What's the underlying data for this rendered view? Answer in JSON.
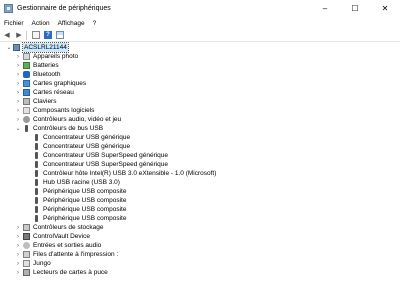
{
  "window": {
    "title": "Gestionnaire de périphériques",
    "minimize": "–",
    "maximize": "☐",
    "close": "✕"
  },
  "menu": [
    "Fichier",
    "Action",
    "Affichage",
    "?"
  ],
  "toolbar": {
    "back": "◀",
    "forward": "▶",
    "help": "?"
  },
  "tree": {
    "root": "ACSLRL21144",
    "categories": [
      "Appareils photo",
      "Batteries",
      "Bluetooth",
      "Cartes graphiques",
      "Cartes réseau",
      "Claviers",
      "Composants logiciels",
      "Contrôleurs audio, vidéo et jeu",
      "Contrôleurs de bus USB"
    ],
    "usb_children": [
      "Concentrateur USB générique",
      "Concentrateur USB générique",
      "Concentrateur USB SuperSpeed générique",
      "Concentrateur USB SuperSpeed générique",
      "Contrôleur hôte Intel(R) USB 3.0 eXtensible - 1.0 (Microsoft)",
      "Hub USB racine (USB 3.0)",
      "Périphérique USB composite",
      "Périphérique USB composite",
      "Périphérique USB composite",
      "Périphérique USB composite"
    ],
    "categories_after": [
      "Contrôleurs de stockage",
      "ControlVault Device",
      "Entrées et sorties audio",
      "Files d'attente à l'impression :",
      "Jungo",
      "Lecteurs de cartes à puce"
    ]
  }
}
